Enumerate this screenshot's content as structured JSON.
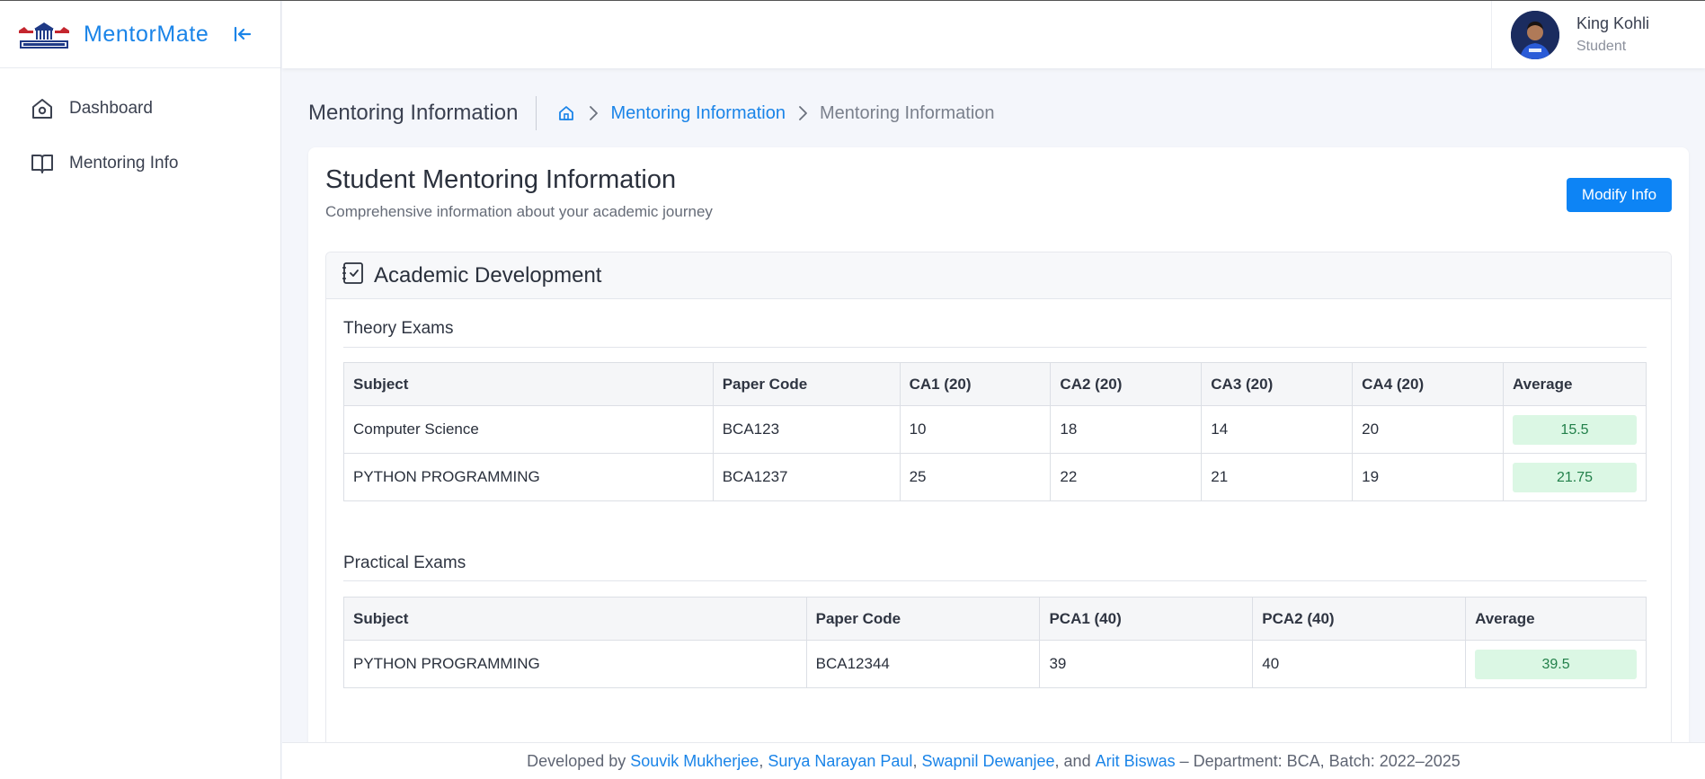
{
  "app": {
    "name": "MentorMate"
  },
  "sidebar": {
    "items": [
      {
        "label": "Dashboard",
        "icon": "home-icon"
      },
      {
        "label": "Mentoring Info",
        "icon": "book-icon"
      }
    ]
  },
  "user": {
    "name": "King Kohli",
    "role": "Student"
  },
  "page": {
    "title": "Mentoring Information",
    "breadcrumb": {
      "link": "Mentoring Information",
      "current": "Mentoring Information"
    }
  },
  "card": {
    "title": "Student Mentoring Information",
    "subtitle": "Comprehensive information about your academic journey",
    "modify_label": "Modify Info"
  },
  "section": {
    "title": "Academic Development",
    "theory": {
      "title": "Theory Exams",
      "headers": [
        "Subject",
        "Paper Code",
        "CA1 (20)",
        "CA2 (20)",
        "CA3 (20)",
        "CA4 (20)",
        "Average"
      ],
      "rows": [
        [
          "Computer Science",
          "BCA123",
          "10",
          "18",
          "14",
          "20",
          "15.5"
        ],
        [
          "PYTHON PROGRAMMING",
          "BCA1237",
          "25",
          "22",
          "21",
          "19",
          "21.75"
        ]
      ]
    },
    "practical": {
      "title": "Practical Exams",
      "headers": [
        "Subject",
        "Paper Code",
        "PCA1 (40)",
        "PCA2 (40)",
        "Average"
      ],
      "rows": [
        [
          "PYTHON PROGRAMMING",
          "BCA12344",
          "39",
          "40",
          "39.5"
        ]
      ]
    }
  },
  "footer": {
    "prefix": "Developed by ",
    "authors": [
      "Souvik Mukherjee",
      "Surya Narayan Paul",
      "Swapnil Dewanjee",
      "Arit Biswas"
    ],
    "sep1": ", ",
    "sep2": ", ",
    "sep3": ", and ",
    "suffix": " – Department: BCA, Batch: 2022–2025"
  },
  "colors": {
    "accent": "#1a84e8",
    "button": "#0d84f5",
    "avg_bg": "#dbf7e4",
    "avg_text": "#22804a"
  }
}
